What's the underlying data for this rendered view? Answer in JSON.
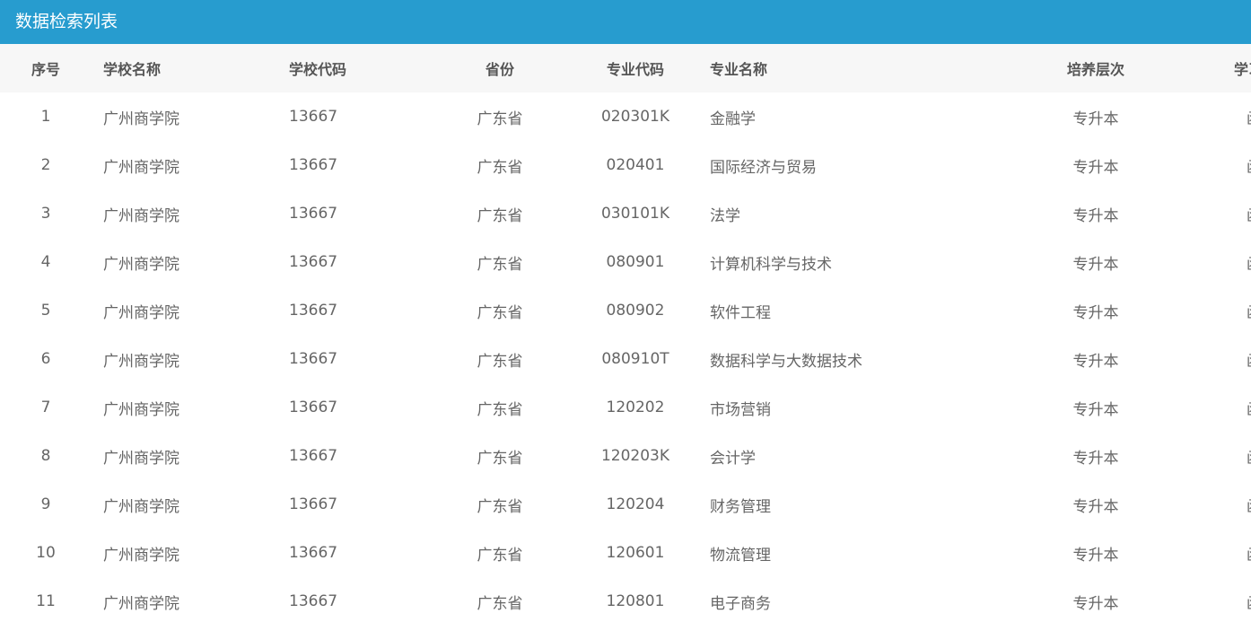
{
  "panel": {
    "title": "数据检索列表"
  },
  "table": {
    "headers": {
      "index": "序号",
      "school_name": "学校名称",
      "school_code": "学校代码",
      "province": "省份",
      "major_code": "专业代码",
      "major_name": "专业名称",
      "level": "培养层次",
      "study_mode": "学习形式"
    },
    "rows": [
      {
        "index": "1",
        "school_name": "广州商学院",
        "school_code": "13667",
        "province": "广东省",
        "major_code": "020301K",
        "major_name": "金融学",
        "level": "专升本",
        "study_mode": "函授"
      },
      {
        "index": "2",
        "school_name": "广州商学院",
        "school_code": "13667",
        "province": "广东省",
        "major_code": "020401",
        "major_name": "国际经济与贸易",
        "level": "专升本",
        "study_mode": "函授"
      },
      {
        "index": "3",
        "school_name": "广州商学院",
        "school_code": "13667",
        "province": "广东省",
        "major_code": "030101K",
        "major_name": "法学",
        "level": "专升本",
        "study_mode": "函授"
      },
      {
        "index": "4",
        "school_name": "广州商学院",
        "school_code": "13667",
        "province": "广东省",
        "major_code": "080901",
        "major_name": "计算机科学与技术",
        "level": "专升本",
        "study_mode": "函授"
      },
      {
        "index": "5",
        "school_name": "广州商学院",
        "school_code": "13667",
        "province": "广东省",
        "major_code": "080902",
        "major_name": "软件工程",
        "level": "专升本",
        "study_mode": "函授"
      },
      {
        "index": "6",
        "school_name": "广州商学院",
        "school_code": "13667",
        "province": "广东省",
        "major_code": "080910T",
        "major_name": "数据科学与大数据技术",
        "level": "专升本",
        "study_mode": "函授"
      },
      {
        "index": "7",
        "school_name": "广州商学院",
        "school_code": "13667",
        "province": "广东省",
        "major_code": "120202",
        "major_name": "市场营销",
        "level": "专升本",
        "study_mode": "函授"
      },
      {
        "index": "8",
        "school_name": "广州商学院",
        "school_code": "13667",
        "province": "广东省",
        "major_code": "120203K",
        "major_name": "会计学",
        "level": "专升本",
        "study_mode": "函授"
      },
      {
        "index": "9",
        "school_name": "广州商学院",
        "school_code": "13667",
        "province": "广东省",
        "major_code": "120204",
        "major_name": "财务管理",
        "level": "专升本",
        "study_mode": "函授"
      },
      {
        "index": "10",
        "school_name": "广州商学院",
        "school_code": "13667",
        "province": "广东省",
        "major_code": "120601",
        "major_name": "物流管理",
        "level": "专升本",
        "study_mode": "函授"
      },
      {
        "index": "11",
        "school_name": "广州商学院",
        "school_code": "13667",
        "province": "广东省",
        "major_code": "120801",
        "major_name": "电子商务",
        "level": "专升本",
        "study_mode": "函授"
      }
    ]
  }
}
